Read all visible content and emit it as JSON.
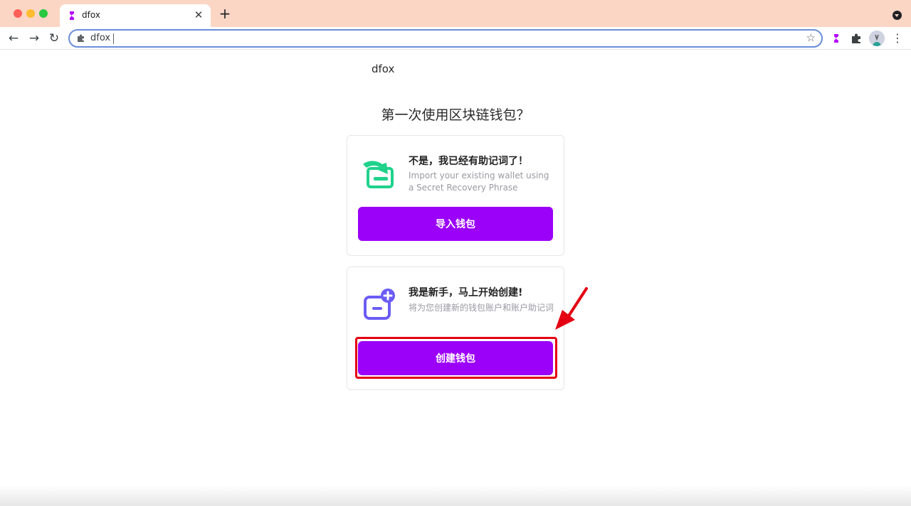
{
  "browser": {
    "tab_title": "dfox",
    "tab_close": "✕",
    "new_tab": "+",
    "omnibox_text": "dfox",
    "nav": {
      "back": "←",
      "forward": "→",
      "reload": "↻"
    },
    "star": "☆",
    "menu": "⋮"
  },
  "page": {
    "site_title": "dfox",
    "heading": "第一次使用区块链钱包？",
    "import_card": {
      "title": "不是，我已经有助记词了！",
      "subtitle": "Import your existing wallet using a Secret Recovery Phrase",
      "button": "导入钱包",
      "icon": "wallet-import-icon"
    },
    "create_card": {
      "title": "我是新手，马上开始创建!",
      "subtitle": "将为您创建新的钱包账户和账户助记词",
      "button": "创建钱包",
      "icon": "wallet-create-icon"
    }
  },
  "colors": {
    "primary_button": "#9b00f8",
    "import_icon": "#1fd28c",
    "create_icon": "#6b5cf5",
    "annotation": "#e40012",
    "tabbar": "#fbd6c5"
  }
}
